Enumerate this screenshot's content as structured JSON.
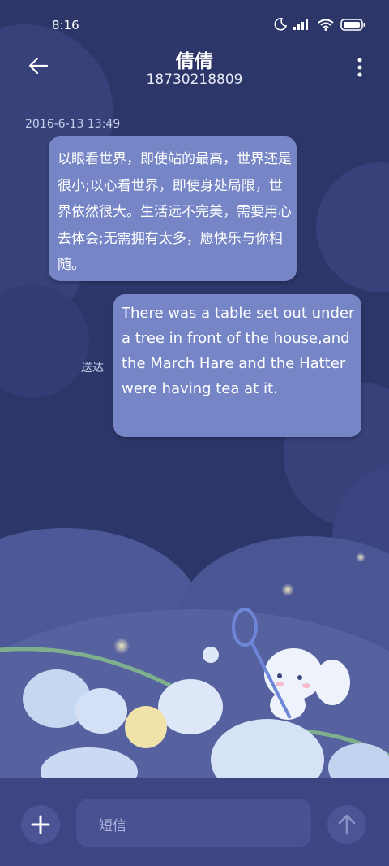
{
  "status_bar": {
    "time": "8:16",
    "icons": [
      "moon-icon",
      "signal-icon",
      "wifi-icon",
      "battery-icon"
    ]
  },
  "header": {
    "contact_name": "倩倩",
    "phone_number": "18730218809"
  },
  "messages": [
    {
      "timestamp": "2016-6-13 13:49",
      "direction": "incoming",
      "text": "以眼看世界，即使站的最高，世界还是很小;以心看世界，即使身处局限，世界依然很大。生活远不完美，需要用心去体会;无需拥有太多，愿快乐与你相随。"
    },
    {
      "direction": "outgoing",
      "status": "送达",
      "text": "There was a table set out under a tree in front of the house,and the March Hare and the Hatter were having tea at it."
    }
  ],
  "composer": {
    "placeholder": "短信"
  },
  "colors": {
    "background": "#2c3566",
    "bubble": "#7585c6",
    "input_bar": "#3d4582"
  }
}
